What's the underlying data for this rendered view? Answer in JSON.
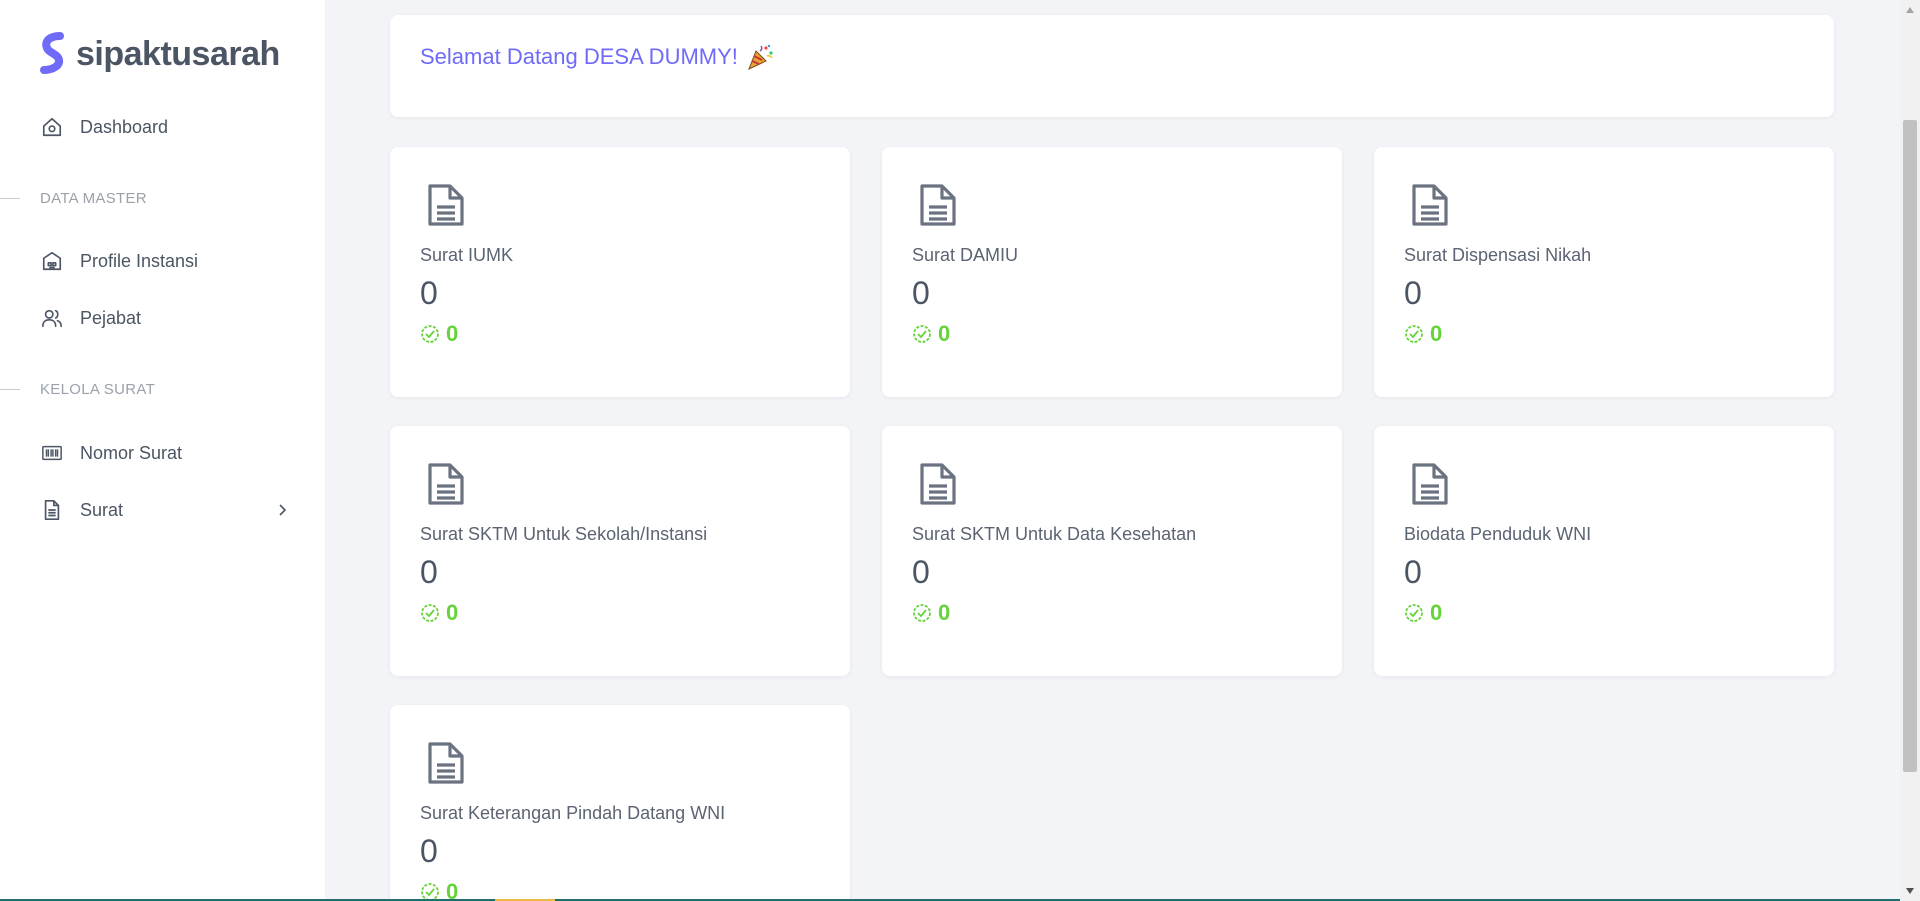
{
  "app": {
    "brand_name": "sipaktusarah",
    "brand_color": "#6f6af8"
  },
  "sidebar": {
    "dashboard": {
      "label": "Dashboard",
      "icon": "home-icon"
    },
    "section_master": "DATA MASTER",
    "profile": {
      "label": "Profile Instansi",
      "icon": "building-icon"
    },
    "pejabat": {
      "label": "Pejabat",
      "icon": "users-icon"
    },
    "section_surat": "KELOLA SURAT",
    "nomor_surat": {
      "label": "Nomor Surat",
      "icon": "barcode-icon"
    },
    "surat": {
      "label": "Surat",
      "icon": "document-icon"
    }
  },
  "welcome": {
    "text": "Selamat Datang DESA DUMMY!",
    "emoji_icon": "party-popper-icon"
  },
  "cards": [
    {
      "title": "Surat IUMK",
      "count": "0",
      "verified": "0"
    },
    {
      "title": "Surat DAMIU",
      "count": "0",
      "verified": "0"
    },
    {
      "title": "Surat Dispensasi Nikah",
      "count": "0",
      "verified": "0"
    },
    {
      "title": "Surat SKTM Untuk Sekolah/Instansi",
      "count": "0",
      "verified": "0"
    },
    {
      "title": "Surat SKTM Untuk Data Kesehatan",
      "count": "0",
      "verified": "0"
    },
    {
      "title": "Biodata Penduduk WNI",
      "count": "0",
      "verified": "0"
    },
    {
      "title": "Surat Keterangan Pindah Datang WNI",
      "count": "0",
      "verified": "0"
    }
  ],
  "colors": {
    "verified": "#65d43a",
    "text": "#4b5563",
    "background": "#f3f4f7"
  }
}
